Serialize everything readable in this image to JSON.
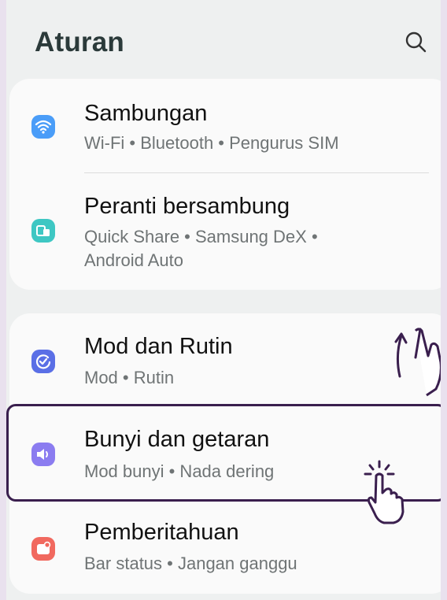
{
  "header": {
    "title": "Aturan",
    "search_icon": "search-icon"
  },
  "groups": [
    {
      "items": [
        {
          "title": "Sambungan",
          "subtitle": "Wi-Fi  •  Bluetooth  •  Pengurus SIM",
          "icon": "wifi-icon",
          "color": "#4a9df8"
        },
        {
          "title": "Peranti bersambung",
          "subtitle_line1": "Quick Share  •  Samsung DeX  •",
          "subtitle_line2": "Android Auto",
          "icon": "devices-icon",
          "color": "#3ec7c3"
        }
      ]
    },
    {
      "items": [
        {
          "title": "Mod dan Rutin",
          "subtitle": "Mod  •  Rutin",
          "icon": "routine-icon",
          "color": "#5a6fe6"
        },
        {
          "title": "Bunyi dan getaran",
          "subtitle": "Mod bunyi  •  Nada dering",
          "icon": "speaker-icon",
          "color": "#8b7cf0"
        },
        {
          "title": "Pemberitahuan",
          "subtitle": "Bar status  •  Jangan ganggu",
          "icon": "notification-icon",
          "color": "#f1695f"
        }
      ]
    }
  ],
  "overlays": {
    "swipe": "swipe-up-hand-icon",
    "tap": "tap-hand-icon",
    "highlight_color": "#3a1f4e"
  }
}
